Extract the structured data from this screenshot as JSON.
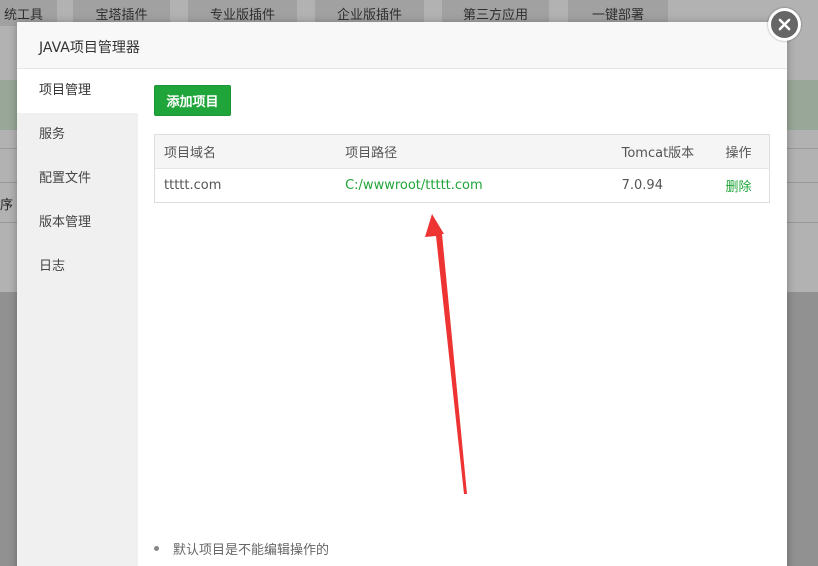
{
  "background": {
    "tabs": [
      "统工具",
      "宝塔插件",
      "专业版插件",
      "企业版插件",
      "第三方应用",
      "一键部署"
    ],
    "row_label": "序"
  },
  "modal": {
    "title": "JAVA项目管理器",
    "sidebar": {
      "items": [
        {
          "label": "项目管理",
          "active": true
        },
        {
          "label": "服务",
          "active": false
        },
        {
          "label": "配置文件",
          "active": false
        },
        {
          "label": "版本管理",
          "active": false
        },
        {
          "label": "日志",
          "active": false
        }
      ]
    },
    "add_button_label": "添加项目",
    "table": {
      "headers": [
        "项目域名",
        "项目路径",
        "Tomcat版本",
        "操作"
      ],
      "rows": [
        {
          "domain": "ttttt.com",
          "path": "C:/wwwroot/ttttt.com",
          "tomcat": "7.0.94",
          "action": "删除"
        }
      ]
    },
    "note": "默认项目是不能编辑操作的"
  },
  "colors": {
    "accent_green": "#20a53a",
    "annotation_arrow": "#ee3333"
  },
  "icons": {
    "close": "close-icon"
  }
}
